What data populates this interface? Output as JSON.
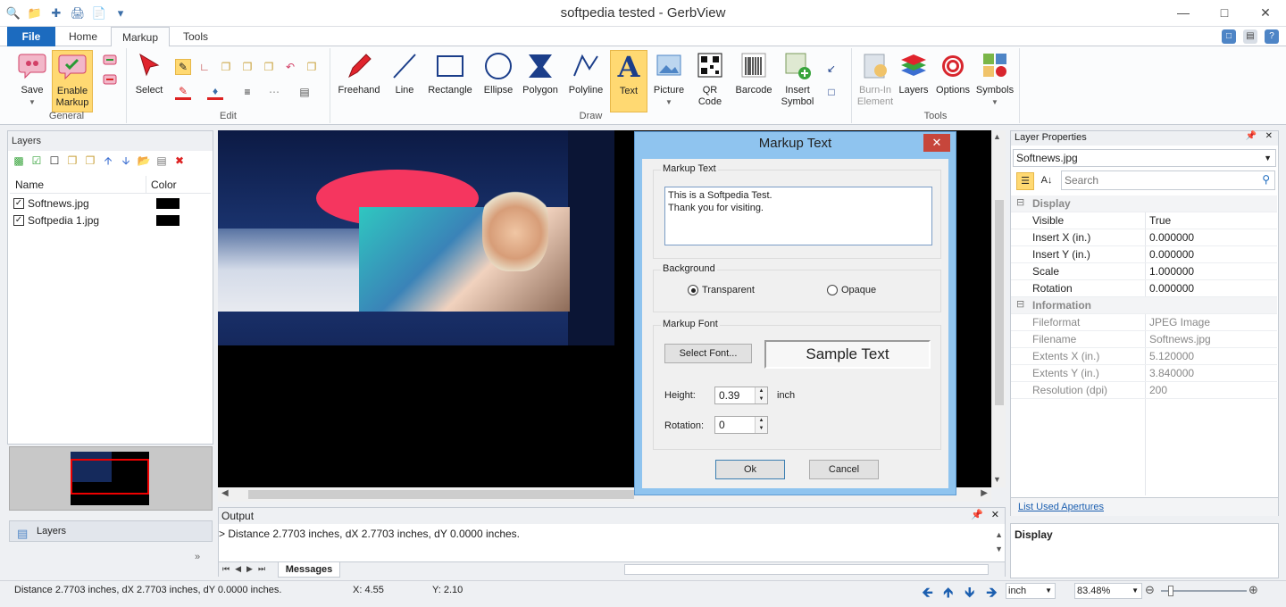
{
  "window": {
    "title": "softpedia tested - GerbView"
  },
  "tabs": {
    "file": "File",
    "home": "Home",
    "markup": "Markup",
    "tools": "Tools"
  },
  "ribbon": {
    "general": {
      "label": "General",
      "save": "Save",
      "enable_markup_1": "Enable",
      "enable_markup_2": "Markup"
    },
    "edit": {
      "label": "Edit",
      "select": "Select"
    },
    "draw": {
      "label": "Draw",
      "freehand": "Freehand",
      "line": "Line",
      "rectangle": "Rectangle",
      "ellipse": "Ellipse",
      "polygon": "Polygon",
      "polyline": "Polyline",
      "text": "Text",
      "picture": "Picture",
      "qr_1": "QR",
      "qr_2": "Code",
      "barcode": "Barcode",
      "insert_symbol_1": "Insert",
      "insert_symbol_2": "Symbol"
    },
    "tools": {
      "label": "Tools",
      "burnin_1": "Burn-In",
      "burnin_2": "Element",
      "layers": "Layers",
      "options": "Options",
      "symbols": "Symbols"
    }
  },
  "layers_panel": {
    "title": "Layers",
    "col_name": "Name",
    "col_color": "Color",
    "items": [
      {
        "name": "Softnews.jpg",
        "checked": true,
        "color": "#000000"
      },
      {
        "name": "Softpedia 1.jpg",
        "checked": true,
        "color": "#000000"
      }
    ],
    "tab_label": "Layers"
  },
  "output": {
    "title": "Output",
    "text": "> Distance 2.7703 inches, dX 2.7703 inches, dY 0.0000 inches.",
    "tab": "Messages"
  },
  "properties": {
    "title": "Layer Properties",
    "selected_object": "Softnews.jpg",
    "search_placeholder": "Search",
    "display_cat": "Display",
    "display_rows": [
      {
        "k": "Visible",
        "v": "True"
      },
      {
        "k": "Insert X (in.)",
        "v": "0.000000"
      },
      {
        "k": "Insert Y (in.)",
        "v": "0.000000"
      },
      {
        "k": "Scale",
        "v": "1.000000"
      },
      {
        "k": "Rotation",
        "v": "0.000000"
      }
    ],
    "info_cat": "Information",
    "info_rows": [
      {
        "k": "Fileformat",
        "v": "JPEG Image"
      },
      {
        "k": "Filename",
        "v": "Softnews.jpg"
      },
      {
        "k": "Extents X (in.)",
        "v": "5.120000"
      },
      {
        "k": "Extents Y (in.)",
        "v": "3.840000"
      },
      {
        "k": "Resolution (dpi)",
        "v": "200"
      }
    ],
    "link": "List Used Apertures",
    "desc_title": "Display"
  },
  "status": {
    "text": "Distance 2.7703 inches, dX 2.7703 inches, dY 0.0000 inches.",
    "x": "X: 4.55",
    "y": "Y: 2.10",
    "unit": "inch",
    "zoom": "83.48%"
  },
  "dialog": {
    "title": "Markup Text",
    "text_group": "Markup Text",
    "text_value_1": "This is a Softpedia Test.",
    "text_value_2": "Thank you for visiting.",
    "bg_group": "Background",
    "transparent": "Transparent",
    "opaque": "Opaque",
    "font_group": "Markup Font",
    "select_font": "Select Font...",
    "sample": "Sample Text",
    "height_label": "Height:",
    "height_value": "0.39",
    "height_unit": "inch",
    "rotation_label": "Rotation:",
    "rotation_value": "0",
    "ok": "Ok",
    "cancel": "Cancel"
  },
  "colors": {
    "accent": "#1c6bbf",
    "dialog_frame": "#8fc4ef",
    "selected_button": "#ffd972"
  }
}
